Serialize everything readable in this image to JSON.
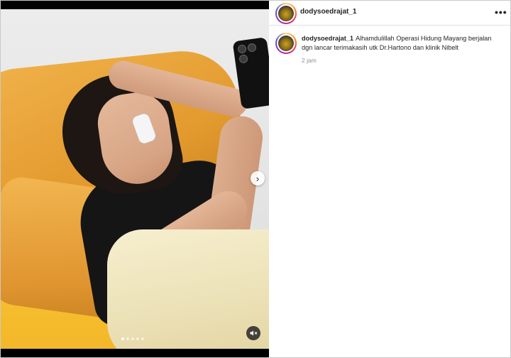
{
  "post": {
    "username": "dodysoedrajat_1",
    "caption_username": "dodysoedrajat_1",
    "caption_text": "Alhamdulillah Operasi Hidung Mayang berjalan dgn lancar terimakasih utk Dr.Hartono dan klinik Nibelt",
    "timestamp": "2 jam",
    "more_label": "•••"
  },
  "media": {
    "next_label": "›",
    "carousel_count": 5,
    "active_index": 0
  },
  "icons": {
    "more": "more-options-icon",
    "next": "chevron-right-icon",
    "mute": "speaker-muted-icon"
  }
}
